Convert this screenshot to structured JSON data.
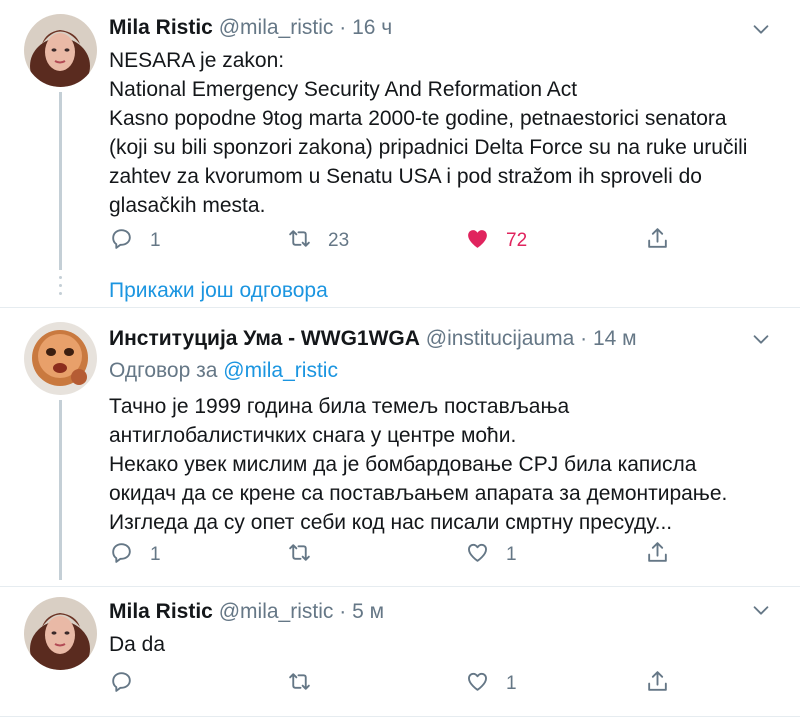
{
  "tweets": [
    {
      "name": "Mila Ristic",
      "handle": "@mila_ristic",
      "separator": "·",
      "time": "16 ч",
      "lines": [
        "NESARA  je zakon:",
        "National Emergency Security And Reformation Act",
        "Kasno popodne 9tog marta 2000-te godine, petnaestorici senatora",
        "(koji su bili sponzori zakona) pripadnici Delta Force su na ruke uručili",
        "zahtev za kvorumom u Senatu USA i pod stražom ih sproveli do",
        "glasačkih mesta."
      ],
      "replies": "1",
      "retweets": "23",
      "likes": "72",
      "liked": true
    },
    {
      "name": "Институција Ума - WWG1WGA",
      "handle": "@institucijauma",
      "separator": "·",
      "time": "14 м",
      "reply_prefix": "Одговор за",
      "reply_mention": "@mila_ristic",
      "lines": [
        "Тачно је 1999 година била темељ постављања",
        "антиглобалистичких снага у центре моћи.",
        "Некако увек мислим да је бомбардовање СРЈ била каписла",
        "окидач да се крене са постављањем апарата за демонтирање.",
        "Изгледа да су опет себи код нас писали смртну пресуду..."
      ],
      "replies": "1",
      "retweets": "",
      "likes": "1",
      "liked": false
    },
    {
      "name": "Mila Ristic",
      "handle": "@mila_ristic",
      "separator": "·",
      "time": "5 м",
      "lines": [
        "Da da"
      ],
      "replies": "",
      "retweets": "",
      "likes": "1",
      "liked": false
    }
  ],
  "show_more_replies": "Прикажи још одговора",
  "icons": {
    "reply": "reply-icon",
    "retweet": "retweet-icon",
    "like": "heart-icon",
    "share": "share-icon",
    "more": "chevron-down-icon"
  },
  "colors": {
    "link": "#1b95e0",
    "secondary": "#657786",
    "like": "#e0245e",
    "thread_line": "#c4cfd6"
  }
}
